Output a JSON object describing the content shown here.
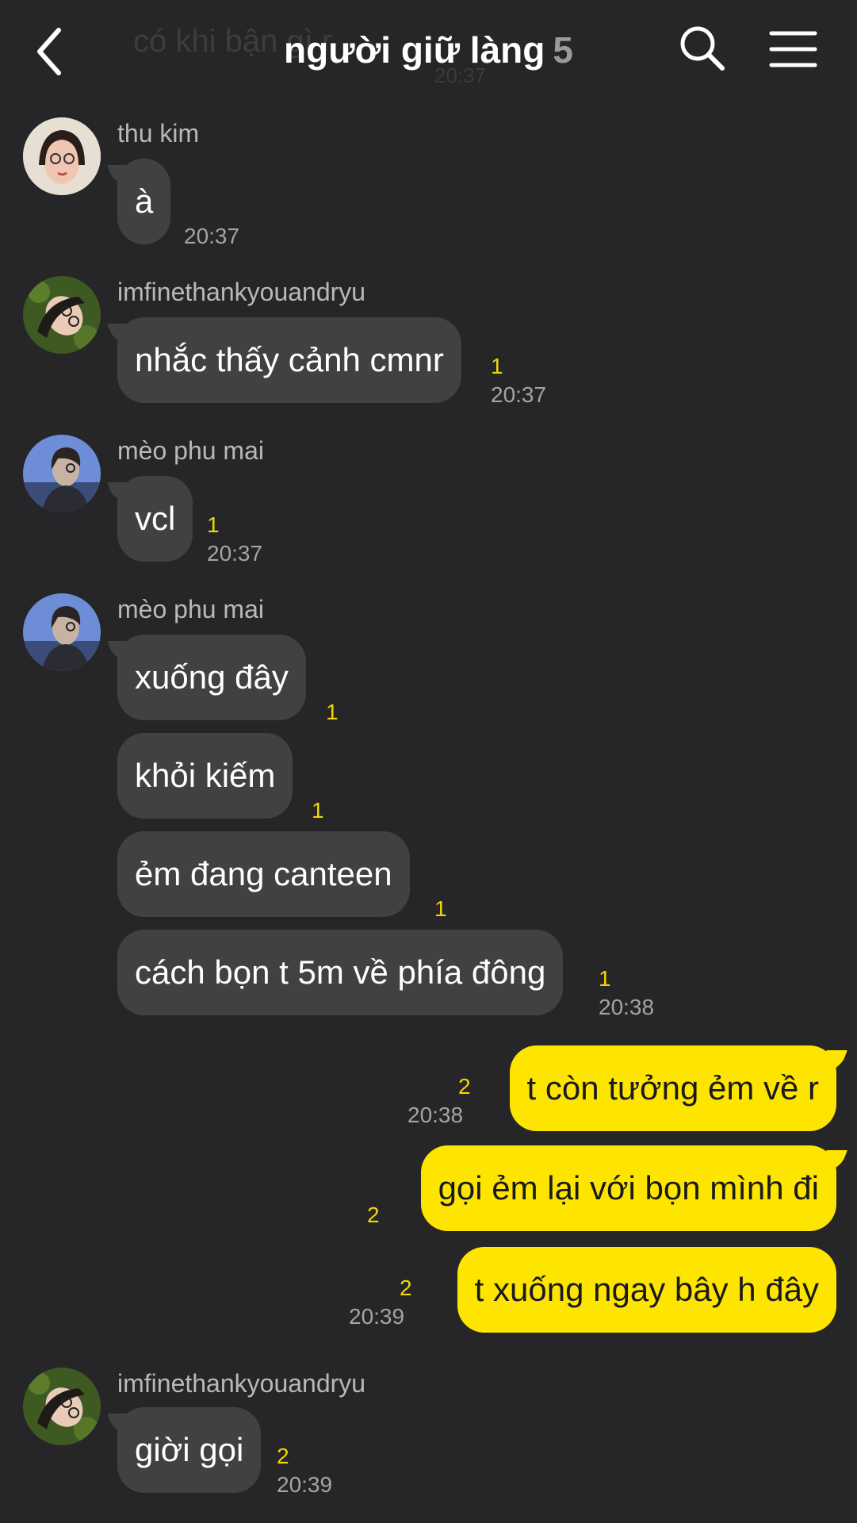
{
  "header": {
    "ghost_text": "có khi bận gì r",
    "ghost_time": "20:37",
    "title": "người giữ làng",
    "member_count": "5",
    "back_icon": "chevron-left-icon",
    "search_icon": "search-icon",
    "menu_icon": "hamburger-menu-icon"
  },
  "colors": {
    "background": "#262628",
    "incoming_bubble": "#414144",
    "outgoing_bubble": "#fee500",
    "unread": "#f2d700"
  },
  "messages": {
    "m1": {
      "sender": "thu kim",
      "text": "à",
      "time": "20:37"
    },
    "m2": {
      "sender": "imfinethankyouandryu",
      "text": "nhắc thấy cảnh cmnr",
      "unread": "1",
      "time": "20:37"
    },
    "m3": {
      "sender": "mèo phu mai",
      "text": "vcl",
      "unread": "1",
      "time": "20:37"
    },
    "g4": {
      "sender": "mèo phu mai",
      "b1": {
        "text": "xuống đây",
        "unread": "1"
      },
      "b2": {
        "text": "khỏi kiếm",
        "unread": "1"
      },
      "b3": {
        "text": "ẻm đang canteen",
        "unread": "1"
      },
      "b4": {
        "text": "cách bọn t 5m về phía đông",
        "unread": "1",
        "time": "20:38"
      }
    },
    "out": {
      "b1": {
        "text": "t còn tưởng ẻm về r",
        "unread": "2",
        "time": "20:38"
      },
      "b2": {
        "text": "gọi ẻm lại với bọn mình đi",
        "unread": "2"
      },
      "b3": {
        "text": "t xuống ngay bây h đây",
        "unread": "2",
        "time": "20:39"
      }
    },
    "m6": {
      "sender": "imfinethankyouandryu",
      "text": "giời gọi",
      "unread": "2",
      "time": "20:39"
    }
  }
}
